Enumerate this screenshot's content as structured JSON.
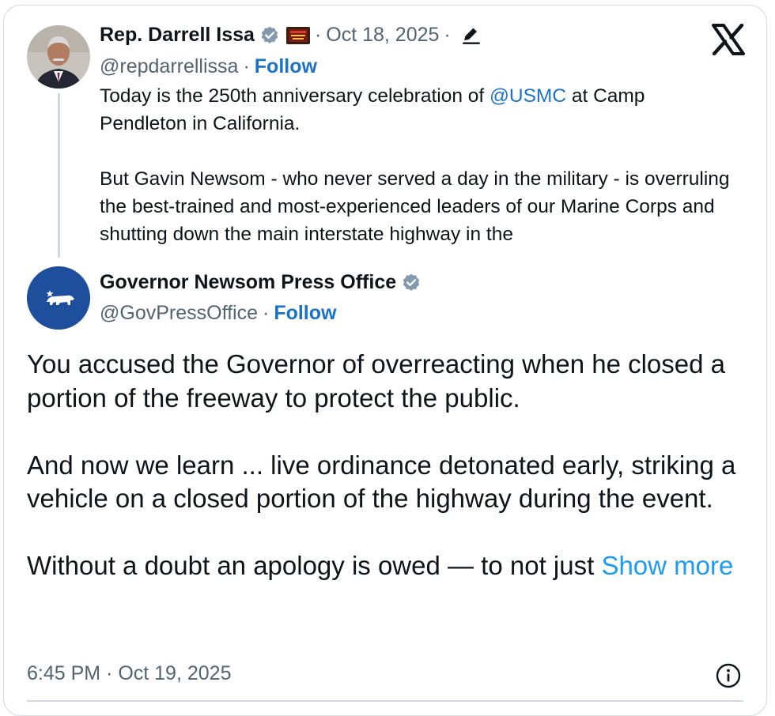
{
  "quoted_post": {
    "author_name": "Rep. Darrell Issa",
    "handle": "@repdarrellissa",
    "follow_label": "Follow",
    "date": "Oct 18, 2025",
    "separator": "·",
    "text_part1_before": "Today is the 250th anniversary celebration of ",
    "text_part1_mention": "@USMC",
    "text_part1_after": " at Camp Pendleton in California.",
    "text_part2": "But Gavin Newsom - who never served a day in the military - is overruling the best-trained and most-experienced leaders of our Marine Corps and shutting down the main interstate highway in the"
  },
  "main_post": {
    "author_name": "Governor Newsom Press Office",
    "handle": "@GovPressOffice",
    "follow_label": "Follow",
    "paragraph1": "You accused the Governor of overreacting when he closed a portion of the freeway to protect the public.",
    "paragraph2": "And now we learn ... live ordinance detonated early, striking a vehicle on a closed portion of the highway during the event.",
    "paragraph3": "Without a doubt an apology is owed — to not just ",
    "show_more_label": "Show more",
    "timestamp": "6:45 PM · Oct 19, 2025"
  },
  "icons": {
    "verified": "verified-badge-icon",
    "edit": "pencil-edit-icon",
    "platform": "x-logo-icon",
    "info": "info-icon",
    "flag": "us-flag-icon"
  },
  "colors": {
    "link": "#1d9bf0",
    "follow": "#1a73c8",
    "muted": "#536471",
    "verified_badge": "#829aab",
    "gov_avatar_bg": "#1e4f9c",
    "border": "#cfd9de"
  }
}
